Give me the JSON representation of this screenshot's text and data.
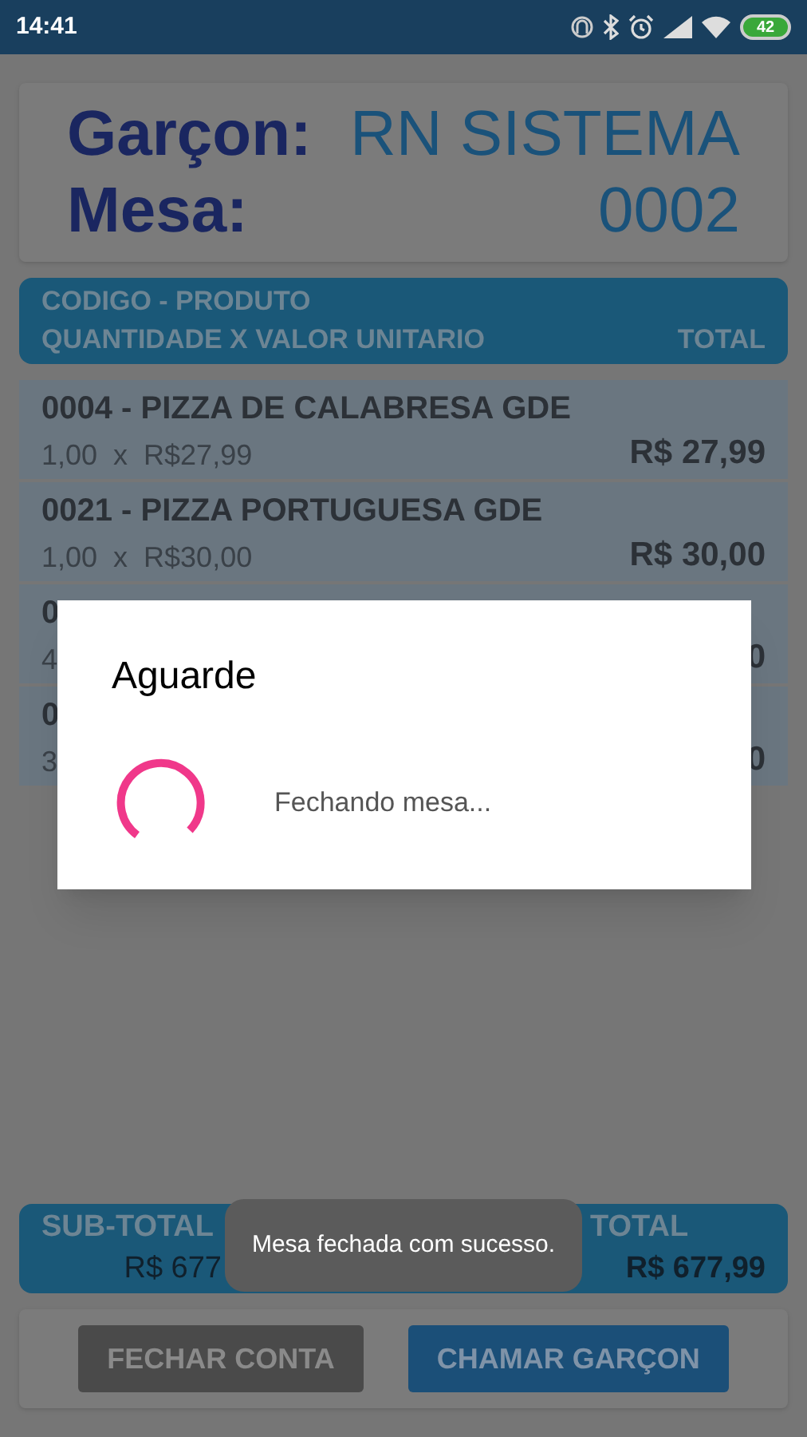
{
  "status_bar": {
    "time": "14:41",
    "battery": "42"
  },
  "header": {
    "waiter_label": "Garçon:",
    "waiter": "RN SISTEMA",
    "table_label": "Mesa:",
    "table": "0002"
  },
  "columns": {
    "line_1": "CODIGO - PRODUTO",
    "line_2_left": "QUANTIDADE X VALOR UNITARIO",
    "line_2_right": "TOTAL"
  },
  "items": [
    {
      "product": "0004 - PIZZA DE CALABRESA GDE",
      "quantity_line": "1,00  x  R$27,99",
      "total": "R$ 27,99"
    },
    {
      "product": "0021 - PIZZA PORTUGUESA GDE",
      "quantity_line": "1,00  x  R$30,00",
      "total": "R$ 30,00"
    },
    {
      "product": "0",
      "quantity_line": "4",
      "total": "0"
    },
    {
      "product": "0",
      "quantity_line": "3",
      "total": "0"
    }
  ],
  "summary": {
    "subtotal_label": "SUB-TOTAL",
    "subtotal": "R$ 677",
    "total_label": "TOTAL",
    "total": "R$ 677,99"
  },
  "buttons": [
    {
      "label": "FECHAR CONTA",
      "kind": "secondary"
    },
    {
      "label": "CHAMAR GARÇON",
      "kind": "primary"
    }
  ],
  "dialog": {
    "title": "Aguarde",
    "message": "Fechando mesa..."
  },
  "toast": "Mesa fechada com sucesso."
}
